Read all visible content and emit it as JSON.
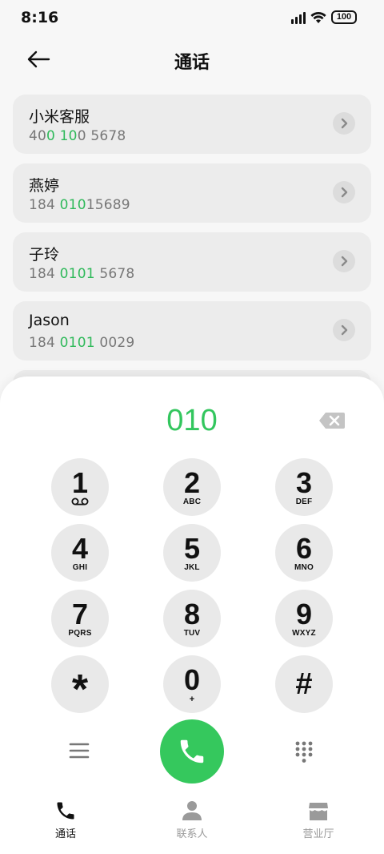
{
  "status": {
    "time": "8:16",
    "battery": "100"
  },
  "header": {
    "title": "通话"
  },
  "contacts": [
    {
      "name": "小米客服",
      "number_parts": [
        "40",
        "0 10",
        "0 5678"
      ]
    },
    {
      "name": "燕婷",
      "number_parts": [
        "184 ",
        "010",
        "15689"
      ]
    },
    {
      "name": "子玲",
      "number_parts": [
        "184 ",
        "0101",
        " 5678"
      ]
    },
    {
      "name": "Jason",
      "number_parts": [
        "184 ",
        "0101",
        " 0029"
      ]
    }
  ],
  "dialpad": {
    "input": "010",
    "keys": [
      {
        "digit": "1",
        "letters": ""
      },
      {
        "digit": "2",
        "letters": "ABC"
      },
      {
        "digit": "3",
        "letters": "DEF"
      },
      {
        "digit": "4",
        "letters": "GHI"
      },
      {
        "digit": "5",
        "letters": "JKL"
      },
      {
        "digit": "6",
        "letters": "MNO"
      },
      {
        "digit": "7",
        "letters": "PQRS"
      },
      {
        "digit": "8",
        "letters": "TUV"
      },
      {
        "digit": "9",
        "letters": "WXYZ"
      },
      {
        "digit": "*",
        "letters": ""
      },
      {
        "digit": "0",
        "letters": "+"
      },
      {
        "digit": "#",
        "letters": ""
      }
    ]
  },
  "nav": {
    "items": [
      {
        "label": "通话",
        "icon": "phone-icon",
        "active": true
      },
      {
        "label": "联系人",
        "icon": "person-icon",
        "active": false
      },
      {
        "label": "营业厅",
        "icon": "store-icon",
        "active": false
      }
    ]
  },
  "colors": {
    "accent": "#33c65e",
    "call": "#35c85d",
    "card": "#ececec",
    "key": "#e9e9e9"
  },
  "icons": [
    "signal-icon",
    "wifi-icon",
    "battery-icon",
    "back-arrow-icon",
    "chevron-right-icon",
    "backspace-icon",
    "voicemail-icon",
    "menu-icon",
    "phone-icon",
    "dialpad-icon",
    "person-icon",
    "store-icon"
  ]
}
